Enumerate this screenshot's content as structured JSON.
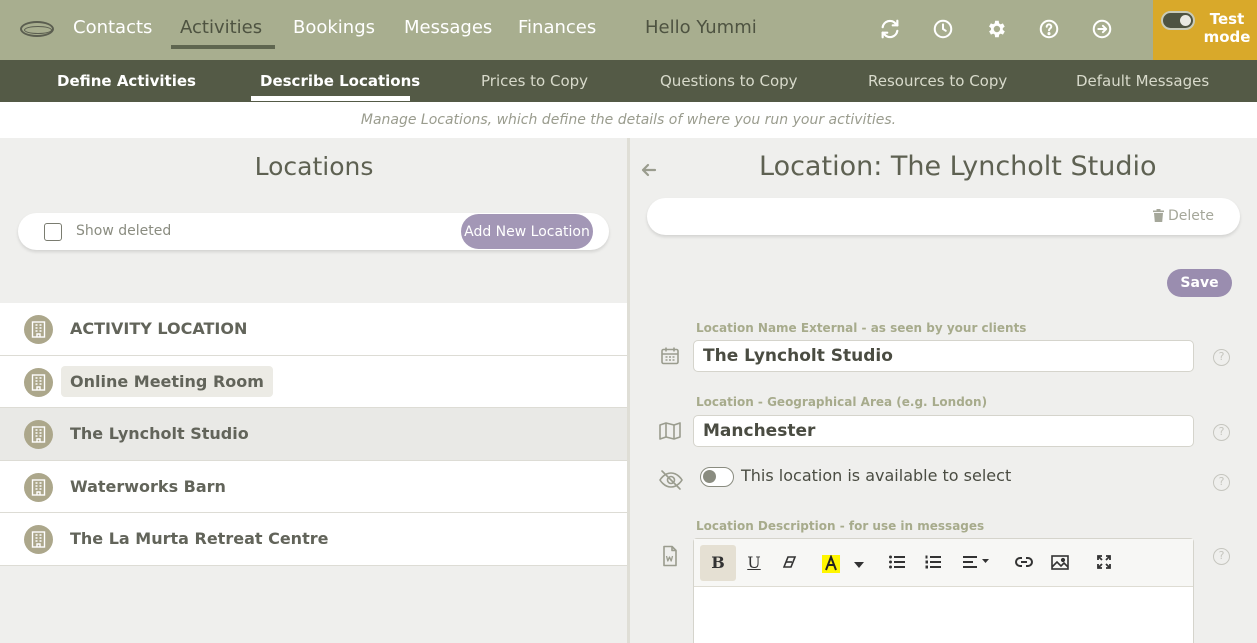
{
  "top_nav": {
    "items": [
      "Contacts",
      "Activities",
      "Bookings",
      "Messages",
      "Finances"
    ],
    "active": "Activities",
    "greeting": "Hello Yummi",
    "test_mode_label": "Test mode"
  },
  "sub_nav": {
    "items": [
      "Define Activities",
      "Describe Locations",
      "Prices to Copy",
      "Questions to Copy",
      "Resources to Copy",
      "Default Messages"
    ],
    "active": "Describe Locations"
  },
  "banner": "Manage Locations, which define the details of where you run your activities.",
  "left": {
    "title": "Locations",
    "show_deleted_label": "Show deleted",
    "add_button": "Add New Location",
    "locations": [
      "ACTIVITY LOCATION",
      "Online Meeting Room",
      "The Lyncholt Studio",
      "Waterworks Barn",
      "The La Murta Retreat Centre"
    ],
    "selected": "The Lyncholt Studio"
  },
  "right": {
    "title": "Location: The Lyncholt Studio",
    "delete_label": "Delete",
    "save_label": "Save",
    "name_label": "Location Name External - as seen by your clients",
    "name_value": "The Lyncholt Studio",
    "area_label": "Location - Geographical Area (e.g. London)",
    "area_value": "Manchester",
    "available_label": "This location is available to select",
    "description_label": "Location Description - for use in messages",
    "help_glyph": "?"
  },
  "colors": {
    "topbar": "#a8ae8f",
    "subnav": "#545a46",
    "test_mode": "#d9a92a",
    "primary_button": "#a397b6",
    "save_button": "#9a8daf"
  }
}
